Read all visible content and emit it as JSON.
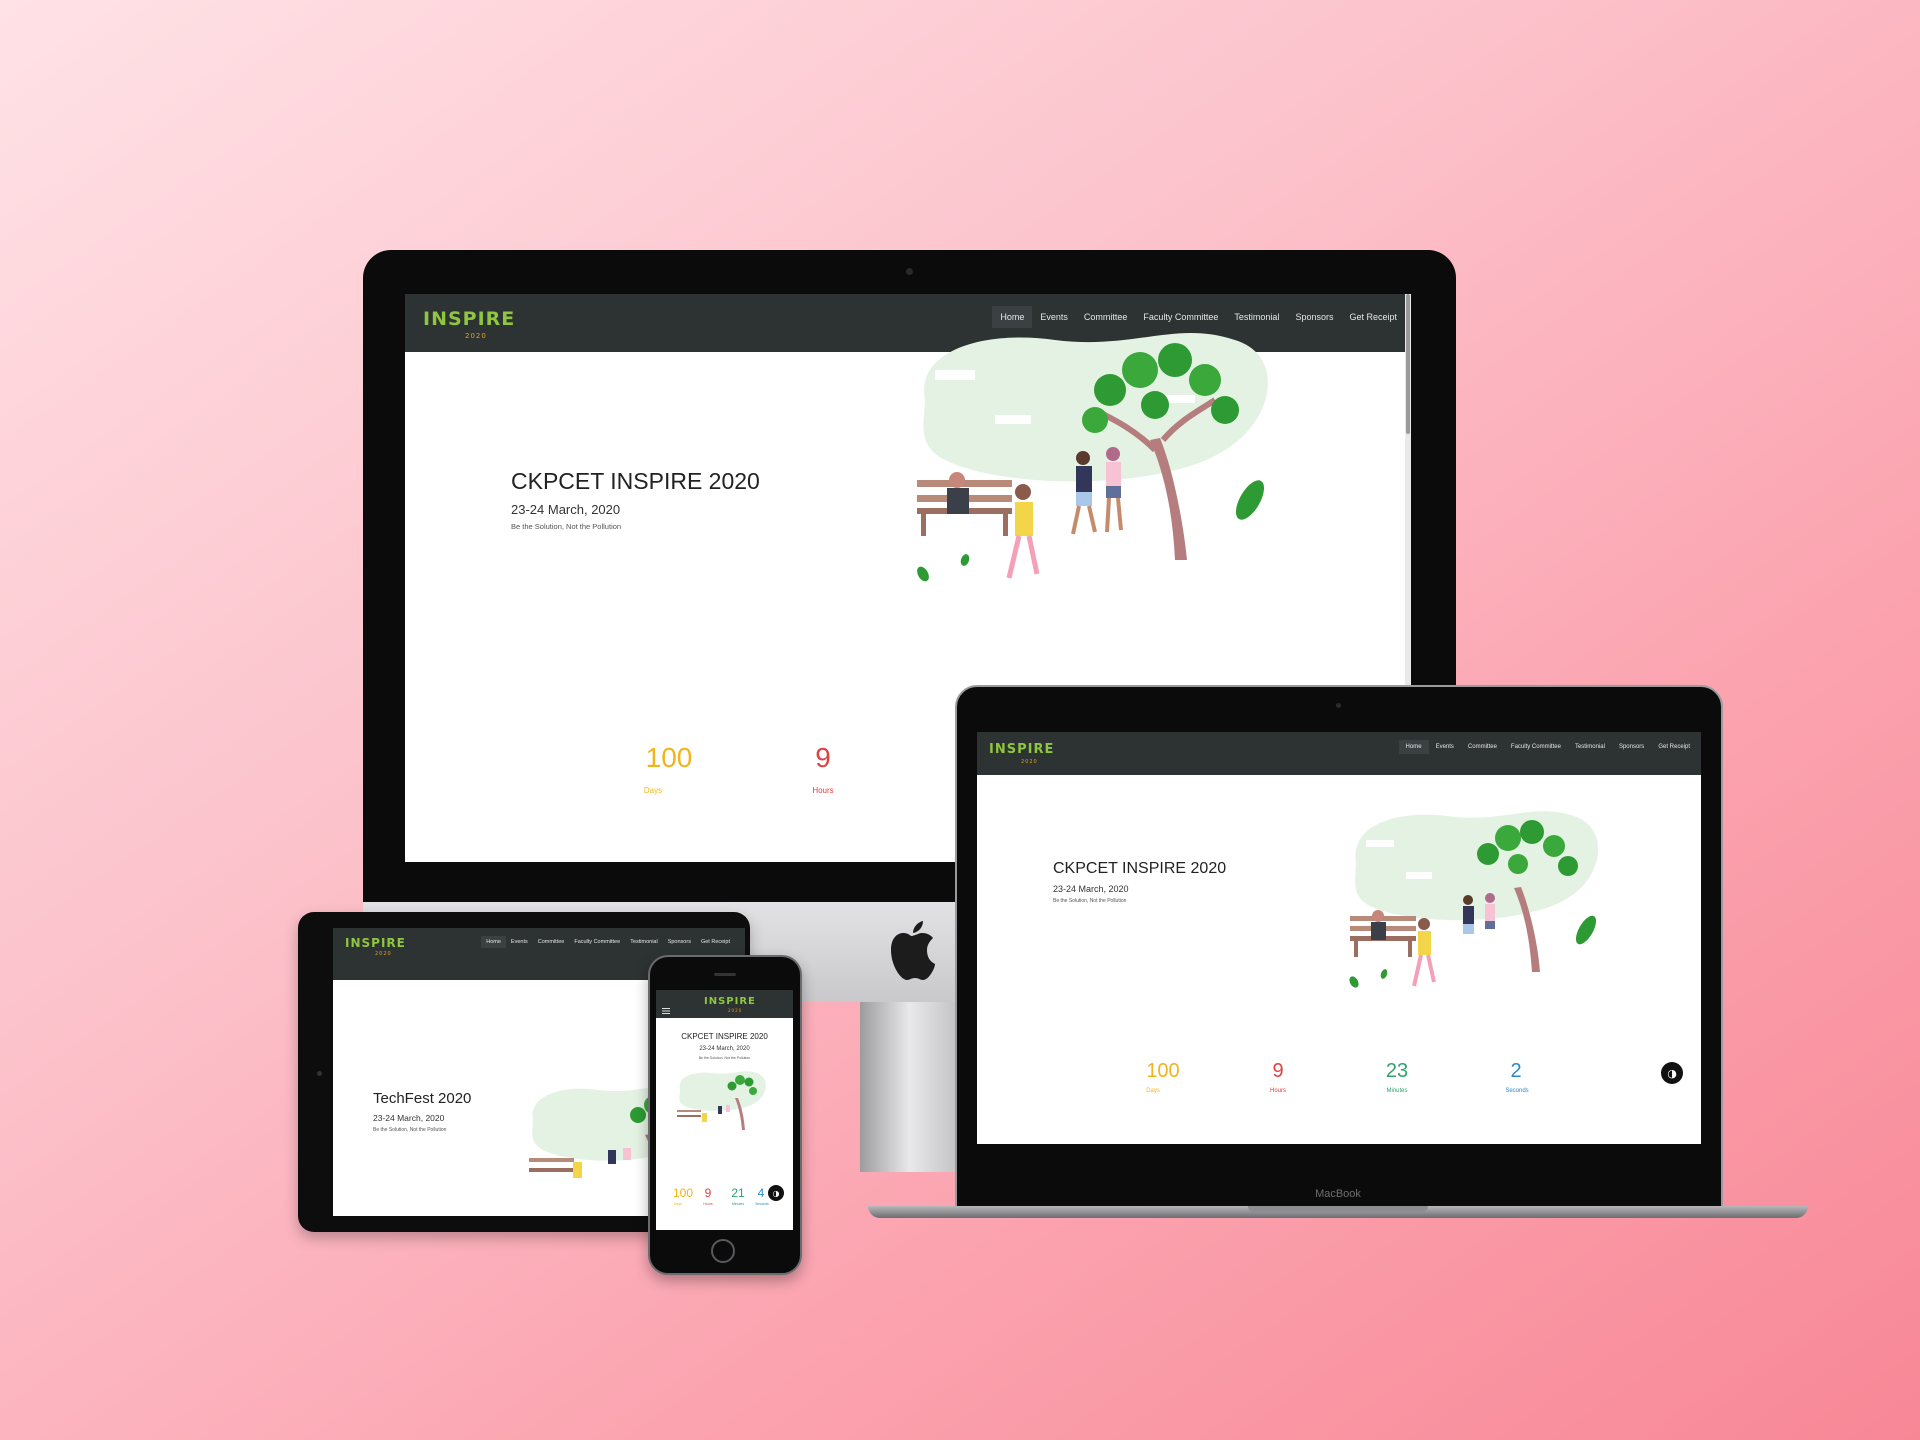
{
  "brand": {
    "logo_main": "INSPIRE",
    "logo_sub": "2020"
  },
  "nav": {
    "items": [
      "Home",
      "Events",
      "Committee",
      "Faculty Committee",
      "Testimonial",
      "Sponsors",
      "Get Receipt"
    ],
    "active": "Home",
    "menu_icon": "hamburger-icon"
  },
  "hero": {
    "title": "CKPCET INSPIRE 2020",
    "date": "23-24 March, 2020",
    "tagline": "Be the Solution, Not the Pollution"
  },
  "tablet_hero": {
    "title": "TechFest 2020",
    "date": "23-24 March, 2020",
    "tagline": "Be the Solution, Not the Pollution"
  },
  "countdown_desktop": {
    "days": {
      "value": "100",
      "label": "Days"
    },
    "hours": {
      "value": "9",
      "label": "Hours"
    }
  },
  "countdown_laptop": {
    "days": {
      "value": "100",
      "label": "Days"
    },
    "hours": {
      "value": "9",
      "label": "Hours"
    },
    "minutes": {
      "value": "23",
      "label": "Minutes"
    },
    "seconds": {
      "value": "2",
      "label": "Seconds"
    }
  },
  "countdown_phone": {
    "days": {
      "value": "100",
      "label": "Days"
    },
    "hours": {
      "value": "9",
      "label": "Hours"
    },
    "minutes": {
      "value": "21",
      "label": "Minutes"
    },
    "seconds": {
      "value": "4",
      "label": "Seconds"
    }
  },
  "device_labels": {
    "laptop_brand": "MacBook"
  },
  "theme_toggle_icon": "◑",
  "colors": {
    "background_top": "#ffe2e6",
    "background_bottom": "#f88796",
    "navbar": "#2d3233",
    "days": "#f0b51a",
    "hours": "#e04141",
    "minutes": "#2fa36b",
    "seconds": "#2b88c8",
    "logo_green": "#8ec63f",
    "logo_orange": "#e6a40e"
  }
}
